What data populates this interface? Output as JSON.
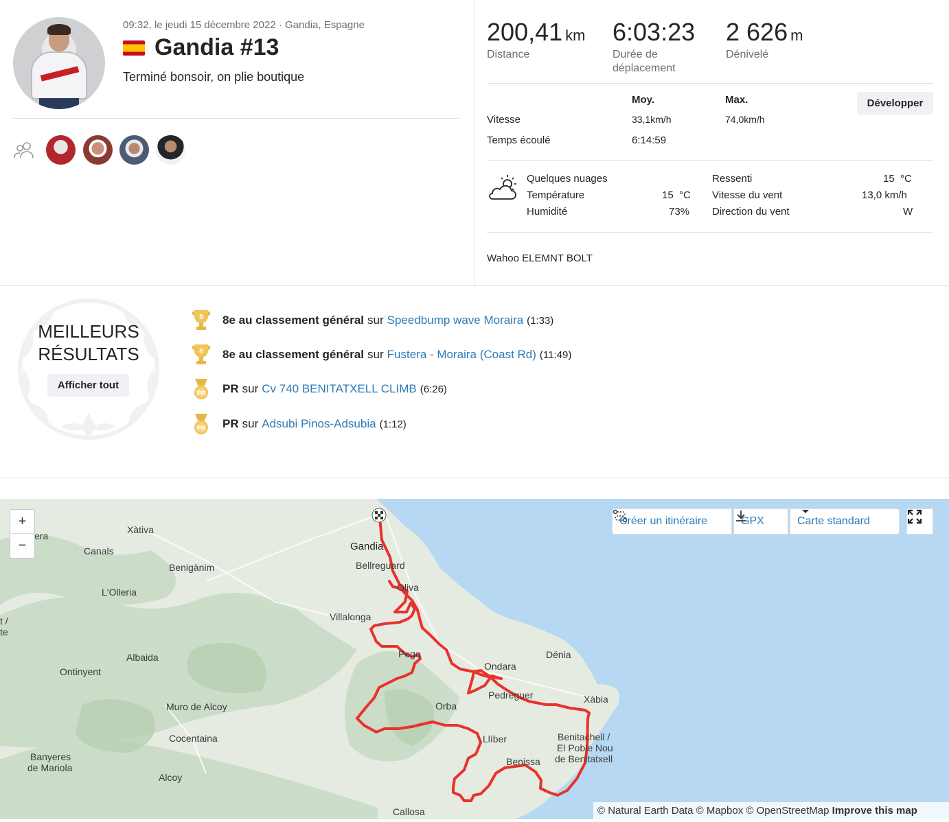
{
  "activity": {
    "meta": "09:32, le jeudi 15 décembre 2022 · Gandia, Espagne",
    "title": "Gandia #13",
    "description": "Terminé bonsoir, on plie boutique"
  },
  "stats": {
    "distance": {
      "value": "200,41",
      "unit": "km",
      "label": "Distance"
    },
    "moving_time": {
      "value": "6:03:23",
      "unit": "",
      "label": "Durée de déplacement"
    },
    "elevation": {
      "value": "2 626",
      "unit": "m",
      "label": "Dénivelé"
    }
  },
  "table": {
    "col_avg": "Moy.",
    "col_max": "Max.",
    "expand_label": "Développer",
    "rows": [
      {
        "label": "Vitesse",
        "avg": "33,1km/h",
        "max": "74,0km/h"
      },
      {
        "label": "Temps écoulé",
        "avg": "6:14:59",
        "max": ""
      }
    ]
  },
  "weather": {
    "condition": "Quelques nuages",
    "temp_label": "Température",
    "temp": "15  °C",
    "humidity_label": "Humidité",
    "humidity": "73%",
    "feels_label": "Ressenti",
    "feels": "15  °C",
    "wind_speed_label": "Vitesse du vent",
    "wind_speed": "13,0 km/h",
    "wind_dir_label": "Direction du vent",
    "wind_dir": "W"
  },
  "device": "Wahoo ELEMNT BOLT",
  "best": {
    "title_line1": "MEILLEURS",
    "title_line2": "RÉSULTATS",
    "show_all": "Afficher tout",
    "items": [
      {
        "badge": "8",
        "strong": "8e au classement général",
        "mid": "sur",
        "segment": "Speedbump wave Moraira",
        "time": "(1:33)"
      },
      {
        "badge": "8",
        "strong": "8e au classement général",
        "mid": "sur",
        "segment": "Fustera - Moraira (Coast Rd)",
        "time": "(11:49)"
      },
      {
        "badge": "PR",
        "strong": "PR",
        "mid": "sur",
        "segment": "Cv 740 BENITATXELL CLIMB",
        "time": "(6:26)"
      },
      {
        "badge": "PR",
        "strong": "PR",
        "mid": "sur",
        "segment": "Adsubi Pinos-Adsubia",
        "time": "(1:12)"
      }
    ]
  },
  "map": {
    "zoom_in": "+",
    "zoom_out": "−",
    "create_route": "Créer un itinéraire",
    "gpx": "GPX",
    "map_type": "Carte standard",
    "attribution": "© Natural Earth Data © Mapbox © OpenStreetMap",
    "improve": "Improve this map",
    "places": {
      "gandia": "Gandia",
      "bellreguard": "Bellreguard",
      "oliva": "Oliva",
      "villalonga": "Villalonga",
      "pego": "Pego",
      "denia": "Dénia",
      "ondara": "Ondara",
      "pedreguer": "Pedreguer",
      "xabia": "Xàbia",
      "orba": "Orba",
      "lliber": "Llíber",
      "benitachell1": "Benitachell /",
      "benitachell2": "El Poble Nou",
      "benitachell3": "de Benitatxell",
      "benissa": "Benissa",
      "callosa": "Callosa",
      "xativa": "Xàtiva",
      "canals": "Canals",
      "benigamim": "Benigànim",
      "olleria": "L'Olleria",
      "albaida": "Albaida",
      "ontinyent": "Ontinyent",
      "muro": "Muro de Alcoy",
      "cocentaina": "Cocentaina",
      "banyeres1": "Banyeres",
      "banyeres2": "de Mariola",
      "alcoy": "Alcoy",
      "era": "era",
      "edge1": "t /",
      "edge2": "te"
    }
  },
  "colors": {
    "route": "#e8322b",
    "link": "#2b7bb9",
    "sea": "#b6d8f2",
    "land": "#e8ede4"
  }
}
